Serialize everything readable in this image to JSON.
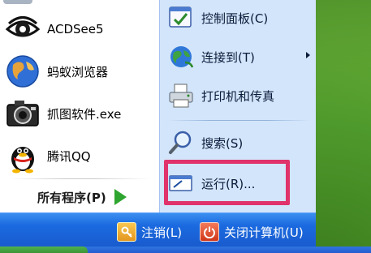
{
  "programs": [
    {
      "label": "ACDSee5",
      "icon": "acdsee-eye-icon"
    },
    {
      "label": "蚂蚁浏览器",
      "icon": "globe-browser-icon"
    },
    {
      "label": "抓图软件.exe",
      "icon": "camera-icon"
    },
    {
      "label": "腾讯QQ",
      "icon": "qq-penguin-icon"
    }
  ],
  "all_programs": {
    "label": "所有程序(P)"
  },
  "right_items": [
    {
      "label": "控制面板(C)",
      "icon": "control-panel-icon"
    },
    {
      "label": "连接到(T)",
      "icon": "connect-globe-icon",
      "submenu": true
    },
    {
      "label": "打印机和传真",
      "icon": "printer-icon"
    },
    {
      "label": "搜索(S)",
      "icon": "search-magnifier-icon"
    },
    {
      "label": "运行(R)...",
      "icon": "run-icon"
    }
  ],
  "bottom": {
    "logoff_label": "注销(L)",
    "shutdown_label": "关闭计算机(U)"
  },
  "colors": {
    "highlight": "#e0326b",
    "right_pane": "#d3e5fa",
    "bottom_bar": "#1b6ae0",
    "all_programs_arrow": "#2ea52e"
  }
}
